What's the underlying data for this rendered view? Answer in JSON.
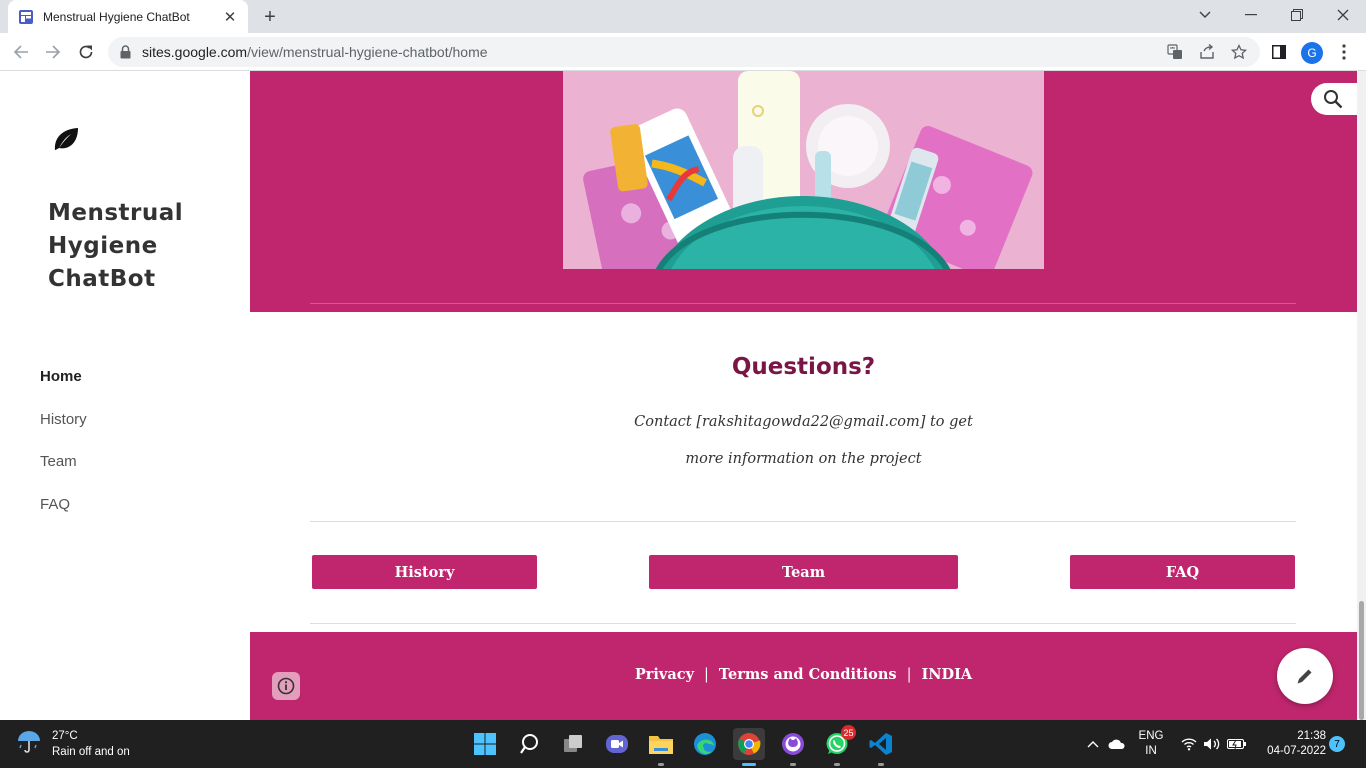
{
  "browser": {
    "tab_title": "Menstrual Hygiene ChatBot",
    "url_host": "sites.google.com",
    "url_path": "/view/menstrual-hygiene-chatbot/home",
    "profile_initial": "G"
  },
  "site": {
    "title": "Menstrual Hygiene ChatBot",
    "nav": [
      "Home",
      "History",
      "Team",
      "FAQ"
    ],
    "active_nav": "Home"
  },
  "questions": {
    "heading": "Questions?",
    "line1": "Contact [rakshitagowda22@gmail.com] to get",
    "line2": "more information on the project"
  },
  "buttons": {
    "history": "History",
    "team": "Team",
    "faq": "FAQ"
  },
  "footer": {
    "privacy": "Privacy",
    "terms": "Terms and Conditions",
    "country": "INDIA",
    "separator": "|"
  },
  "taskbar": {
    "temperature": "27°C",
    "weather": "Rain off and on",
    "whatsapp_badge": "25",
    "lang_1": "ENG",
    "lang_2": "IN",
    "time": "21:38",
    "date": "04-07-2022",
    "notifications": "7"
  },
  "colors": {
    "brand": "#c0266d",
    "heading": "#7a1645",
    "accent": "#4cc2ff"
  }
}
